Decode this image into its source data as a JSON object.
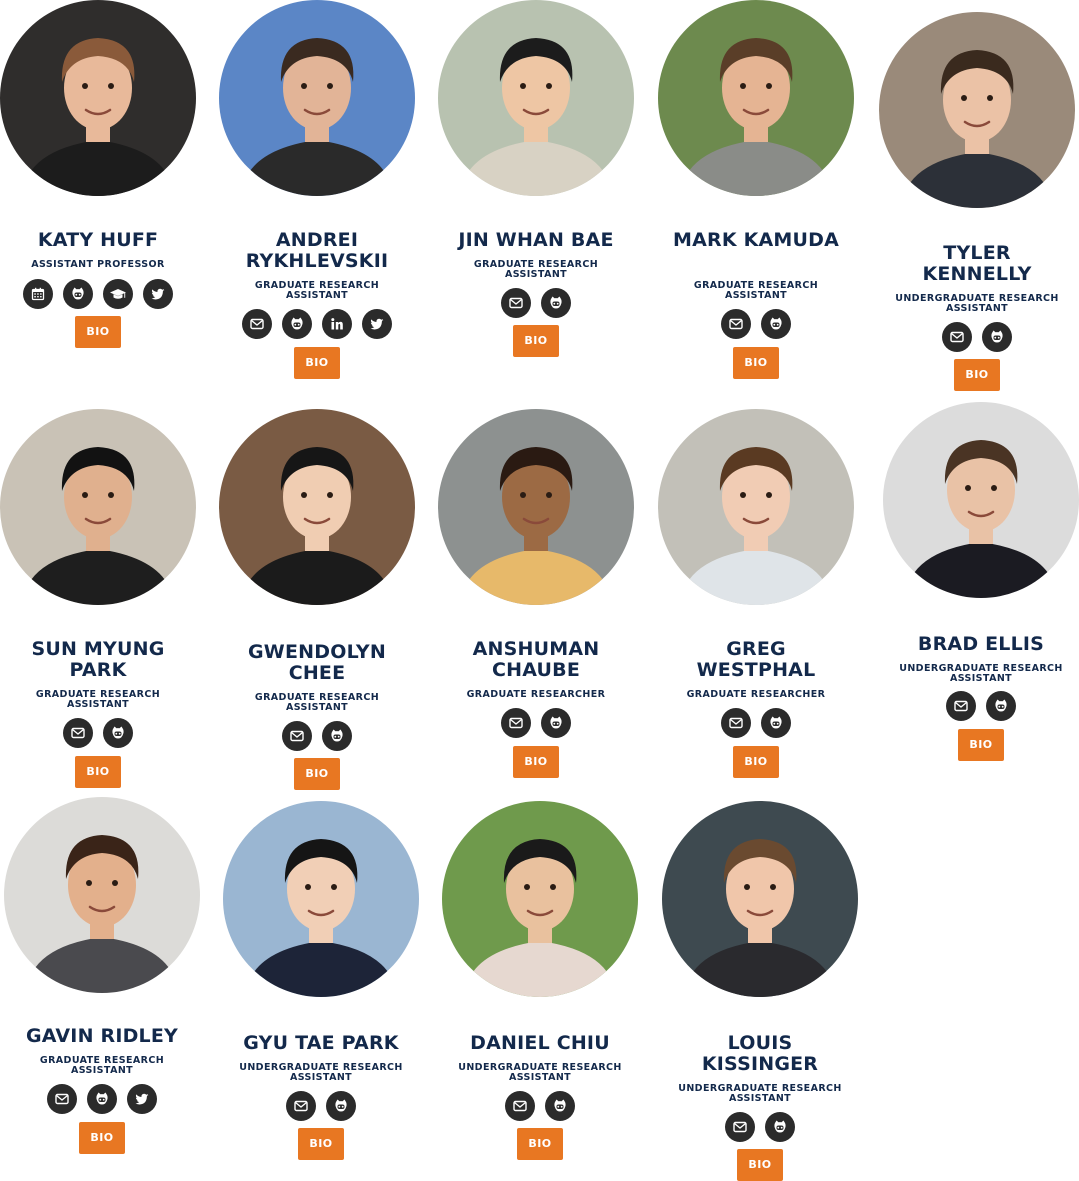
{
  "people": [
    {
      "name": "KATY HUFF",
      "title": "ASSISTANT PROFESSOR",
      "icons": [
        "calendar-icon",
        "github-icon",
        "graduation-cap-icon",
        "twitter-icon"
      ],
      "bio": "BIO",
      "bg": "#2f2d2c",
      "skin": "#e8b99a",
      "hair": "#8a5a3a",
      "shirt": "#1c1c1c"
    },
    {
      "name": "ANDREI RYKHLEVSKII",
      "title": "GRADUATE RESEARCH ASSISTANT",
      "icons": [
        "email-icon",
        "github-icon",
        "linkedin-icon",
        "twitter-icon"
      ],
      "bio": "BIO",
      "bg": "#5b86c6",
      "skin": "#e2b497",
      "hair": "#3a2a20",
      "shirt": "#2a2a2a"
    },
    {
      "name": "JIN WHAN BAE",
      "title": "GRADUATE RESEARCH ASSISTANT",
      "icons": [
        "email-icon",
        "github-icon"
      ],
      "bio": "BIO",
      "bg": "#b8c2b0",
      "skin": "#eec6a4",
      "hair": "#1c1c1c",
      "shirt": "#d8d2c4"
    },
    {
      "name": "MARK KAMUDA",
      "title": "GRADUATE RESEARCH ASSISTANT",
      "icons": [
        "email-icon",
        "github-icon"
      ],
      "bio": "BIO",
      "bg": "#6d8a4e",
      "skin": "#e5b493",
      "hair": "#5a3e28",
      "shirt": "#8a8c88"
    },
    {
      "name": "TYLER KENNELLY",
      "title": "UNDERGRADUATE RESEARCH ASSISTANT",
      "icons": [
        "email-icon",
        "github-icon"
      ],
      "bio": "BIO",
      "bg": "#9a8a7a",
      "skin": "#ebc2a6",
      "hair": "#3a2a1e",
      "shirt": "#2c3038"
    },
    {
      "name": "SUN MYUNG PARK",
      "title": "GRADUATE RESEARCH ASSISTANT",
      "icons": [
        "email-icon",
        "github-icon"
      ],
      "bio": "BIO",
      "bg": "#c9c2b6",
      "skin": "#e0b08e",
      "hair": "#121212",
      "shirt": "#1e1e1e"
    },
    {
      "name": "GWENDOLYN CHEE",
      "title": "GRADUATE RESEARCH ASSISTANT",
      "icons": [
        "email-icon",
        "github-icon"
      ],
      "bio": "BIO",
      "bg": "#7a5b44",
      "skin": "#f0cdb2",
      "hair": "#161616",
      "shirt": "#1b1b1b"
    },
    {
      "name": "ANSHUMAN CHAUBE",
      "title": "GRADUATE RESEARCHER",
      "icons": [
        "email-icon",
        "github-icon"
      ],
      "bio": "BIO",
      "bg": "#8d9190",
      "skin": "#9c6a44",
      "hair": "#2a1a12",
      "shirt": "#e7b96a"
    },
    {
      "name": "GREG WESTPHAL",
      "title": "GRADUATE RESEARCHER",
      "icons": [
        "email-icon",
        "github-icon"
      ],
      "bio": "BIO",
      "bg": "#c2c0b8",
      "skin": "#f1ccb4",
      "hair": "#5a3a22",
      "shirt": "#dfe4e8"
    },
    {
      "name": "BRAD ELLIS",
      "title": "UNDERGRADUATE RESEARCH ASSISTANT",
      "icons": [
        "email-icon",
        "github-icon"
      ],
      "bio": "BIO",
      "bg": "#dcdcdc",
      "skin": "#e9c2a6",
      "hair": "#4a3424",
      "shirt": "#1b1b22"
    },
    {
      "name": "GAVIN RIDLEY",
      "title": "GRADUATE RESEARCH ASSISTANT",
      "icons": [
        "email-icon",
        "github-icon",
        "twitter-icon"
      ],
      "bio": "BIO",
      "bg": "#dcdbd8",
      "skin": "#e3b08c",
      "hair": "#3a2418",
      "shirt": "#4a4a4e"
    },
    {
      "name": "GYU TAE PARK",
      "title": "UNDERGRADUATE RESEARCH ASSISTANT",
      "icons": [
        "email-icon",
        "github-icon"
      ],
      "bio": "BIO",
      "bg": "#9ab6d2",
      "skin": "#f1cfb6",
      "hair": "#151515",
      "shirt": "#1d2438"
    },
    {
      "name": "DANIEL CHIU",
      "title": "UNDERGRADUATE RESEARCH ASSISTANT",
      "icons": [
        "email-icon",
        "github-icon"
      ],
      "bio": "BIO",
      "bg": "#6f9a4c",
      "skin": "#e9c19e",
      "hair": "#1a1a1a",
      "shirt": "#e6d8d0"
    },
    {
      "name": "LOUIS KISSINGER",
      "title": "UNDERGRADUATE RESEARCH ASSISTANT",
      "icons": [
        "email-icon",
        "github-icon"
      ],
      "bio": "BIO",
      "bg": "#3e4a50",
      "skin": "#f0c6aa",
      "hair": "#6a4a30",
      "shirt": "#2a2a2e"
    }
  ]
}
